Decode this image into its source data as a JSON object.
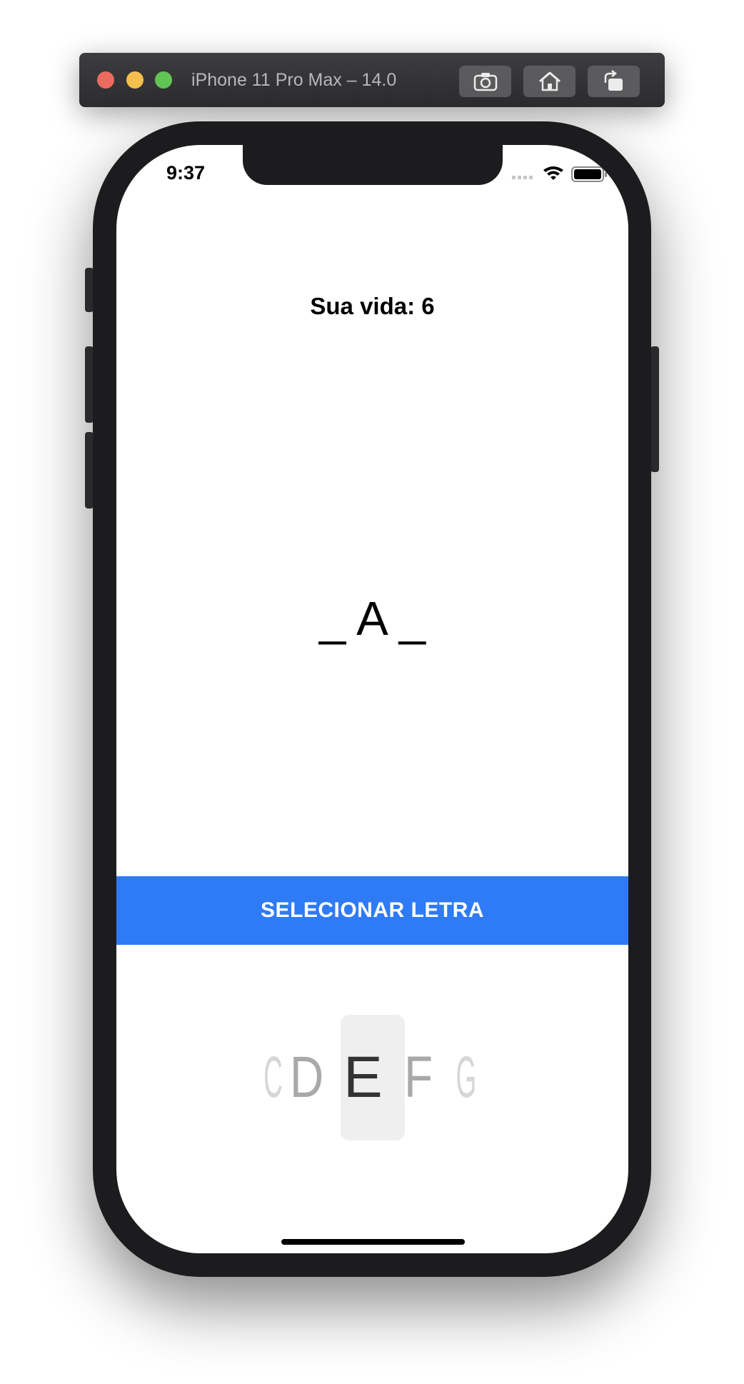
{
  "window": {
    "title": "iPhone 11 Pro Max – 14.0",
    "buttons": [
      "screenshot-icon",
      "home-icon",
      "rotate-icon"
    ]
  },
  "status_bar": {
    "time": "9:37",
    "icons": [
      "cellular-icon",
      "wifi-icon",
      "battery-icon"
    ]
  },
  "game": {
    "life_label": "Sua vida: 6",
    "word_display": "_ A _",
    "select_button_label": "SELECIONAR LETRA"
  },
  "picker": {
    "letters": [
      "C",
      "D",
      "E",
      "F",
      "G"
    ],
    "selected": "E"
  },
  "colors": {
    "accent": "#2f7bf5",
    "selected_letter": "#333333",
    "dim_letter": "#a9a9a9"
  }
}
